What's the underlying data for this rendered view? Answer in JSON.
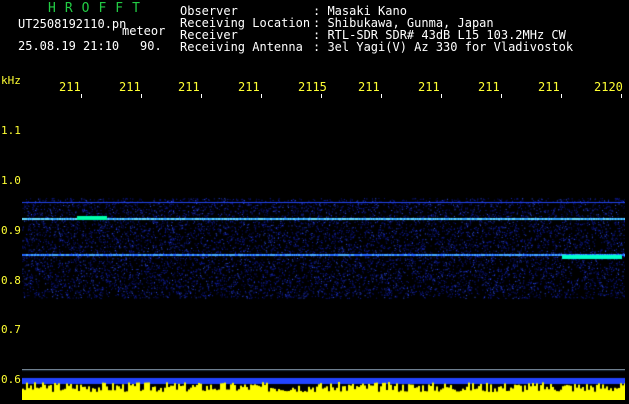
{
  "header": {
    "brand": "HROFFT",
    "filename": "UT2508192110.pn",
    "category": "meteor",
    "datetime": "25.08.19 21:10",
    "count": "90.",
    "fields": [
      {
        "label": "Observer",
        "value": ": Masaki Kano"
      },
      {
        "label": "Receiving Location",
        "value": ": Shibukawa, Gunma, Japan"
      },
      {
        "label": "Receiver",
        "value": ": RTL-SDR SDR# 43dB L15 103.2MHz CW"
      },
      {
        "label": "Receiving Antenna",
        "value": ": 3el Yagi(V) Az 330 for Vladivostok"
      }
    ]
  },
  "axis": {
    "unit": "kHz",
    "x_ticks": [
      "211",
      "211",
      "211",
      "211",
      "2115",
      "211",
      "211",
      "211",
      "211",
      "2120"
    ],
    "y_ticks": [
      "1.1",
      "1.0",
      "0.9",
      "0.8",
      "0.7",
      "0.6"
    ]
  },
  "colors": {
    "text": "#ffffff",
    "tick": "#ffff33",
    "brand": "#22cc44",
    "signal": "#00ffcc",
    "noise": "#0022cc"
  }
}
